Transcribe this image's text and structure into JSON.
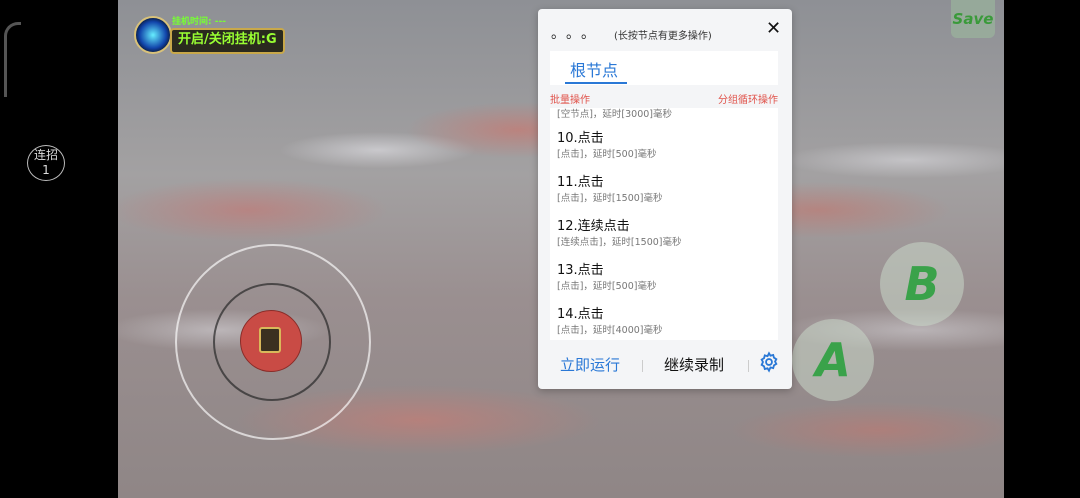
{
  "side": {
    "combo_label": "连招",
    "combo_count": "1"
  },
  "hud": {
    "timer_label": "挂机时间: ---",
    "toggle_label": "开启/关闭挂机:G",
    "save_label": "Save"
  },
  "controls": {
    "b_label": "B",
    "a_label": "A"
  },
  "panel": {
    "dots": "。。。",
    "hint": "(长按节点有更多操作)",
    "close_icon": "close-icon",
    "tab_root": "根节点",
    "batch_op": "批量操作",
    "group_loop_op": "分组循环操作",
    "partial_item_desc": "[空节点]，延时[3000]毫秒",
    "items": [
      {
        "title": "10.点击",
        "desc": "[点击]，延时[500]毫秒"
      },
      {
        "title": "11.点击",
        "desc": "[点击]，延时[1500]毫秒"
      },
      {
        "title": "12.连续点击",
        "desc": "[连续点击]，延时[1500]毫秒"
      },
      {
        "title": "13.点击",
        "desc": "[点击]，延时[500]毫秒"
      },
      {
        "title": "14.点击",
        "desc": "[点击]，延时[4000]毫秒"
      }
    ],
    "run_now": "立即运行",
    "continue_recording": "继续录制",
    "settings_icon": "gear-icon"
  },
  "colors": {
    "accent_blue": "#2a78d6",
    "accent_red": "#e0524a",
    "joystick_knob": "#c94b45",
    "button_green": "#3aa24a"
  }
}
